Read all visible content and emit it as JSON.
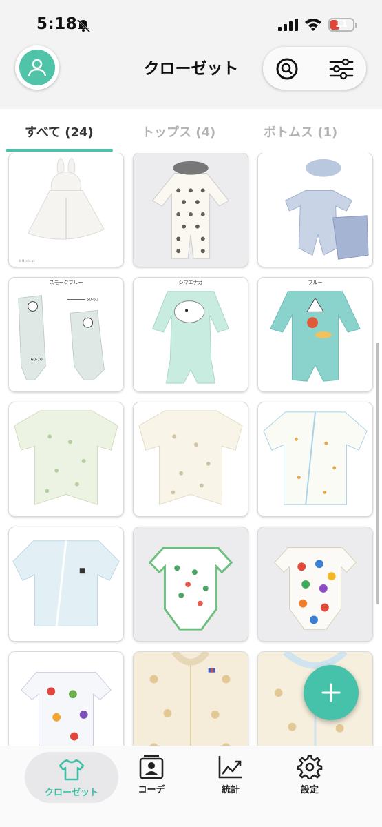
{
  "status_bar": {
    "time": "5:18",
    "battery": "11",
    "icons": [
      "bell-slash-icon",
      "cellular-signal-icon",
      "wifi-icon",
      "battery-icon"
    ]
  },
  "header": {
    "title": "クローゼット",
    "icons": [
      "user-avatar-icon",
      "search-icon",
      "filter-sliders-icon"
    ]
  },
  "tabs": [
    {
      "label": "すべて (24)",
      "active": true
    },
    {
      "label": "トップス (4)",
      "active": false
    },
    {
      "label": "ボトムス (1)",
      "active": false
    }
  ],
  "clothing_items": [
    {
      "name": "bunny-hood-poncho",
      "caption": ""
    },
    {
      "name": "polka-dot-romper",
      "caption": ""
    },
    {
      "name": "blue-stripe-romper-set",
      "caption": ""
    },
    {
      "name": "panda-coverall",
      "caption": "スモークブルー"
    },
    {
      "name": "bird-coverall",
      "caption": "シマエナガ"
    },
    {
      "name": "onigiri-coverall",
      "caption": "ブルー"
    },
    {
      "name": "green-print-dress",
      "caption": ""
    },
    {
      "name": "cream-print-dress",
      "caption": ""
    },
    {
      "name": "tiny-print-wrap-top",
      "caption": ""
    },
    {
      "name": "light-blue-wrap-top",
      "caption": ""
    },
    {
      "name": "miffy-bodysuit",
      "caption": ""
    },
    {
      "name": "color-dot-bodysuit",
      "caption": ""
    },
    {
      "name": "fruit-wrap-bodysuit",
      "caption": ""
    },
    {
      "name": "bear-knit-top",
      "caption": ""
    },
    {
      "name": "bear-knit-top-2",
      "caption": ""
    }
  ],
  "annotations": {
    "size_small": "50-60",
    "size_large": "60-70",
    "copyright": "© Mercis bv"
  },
  "fab": {
    "icon": "plus-icon"
  },
  "bottom_nav": [
    {
      "label": "クローゼット",
      "icon": "shirt-icon",
      "active": true
    },
    {
      "label": "コーデ",
      "icon": "outfit-card-icon",
      "active": false
    },
    {
      "label": "統計",
      "icon": "chart-icon",
      "active": false
    },
    {
      "label": "設定",
      "icon": "gear-icon",
      "active": false
    }
  ],
  "colors": {
    "accent": "#45c2a9",
    "tab_inactive": "#b3b3b3",
    "battery_low": "#e0453a"
  }
}
